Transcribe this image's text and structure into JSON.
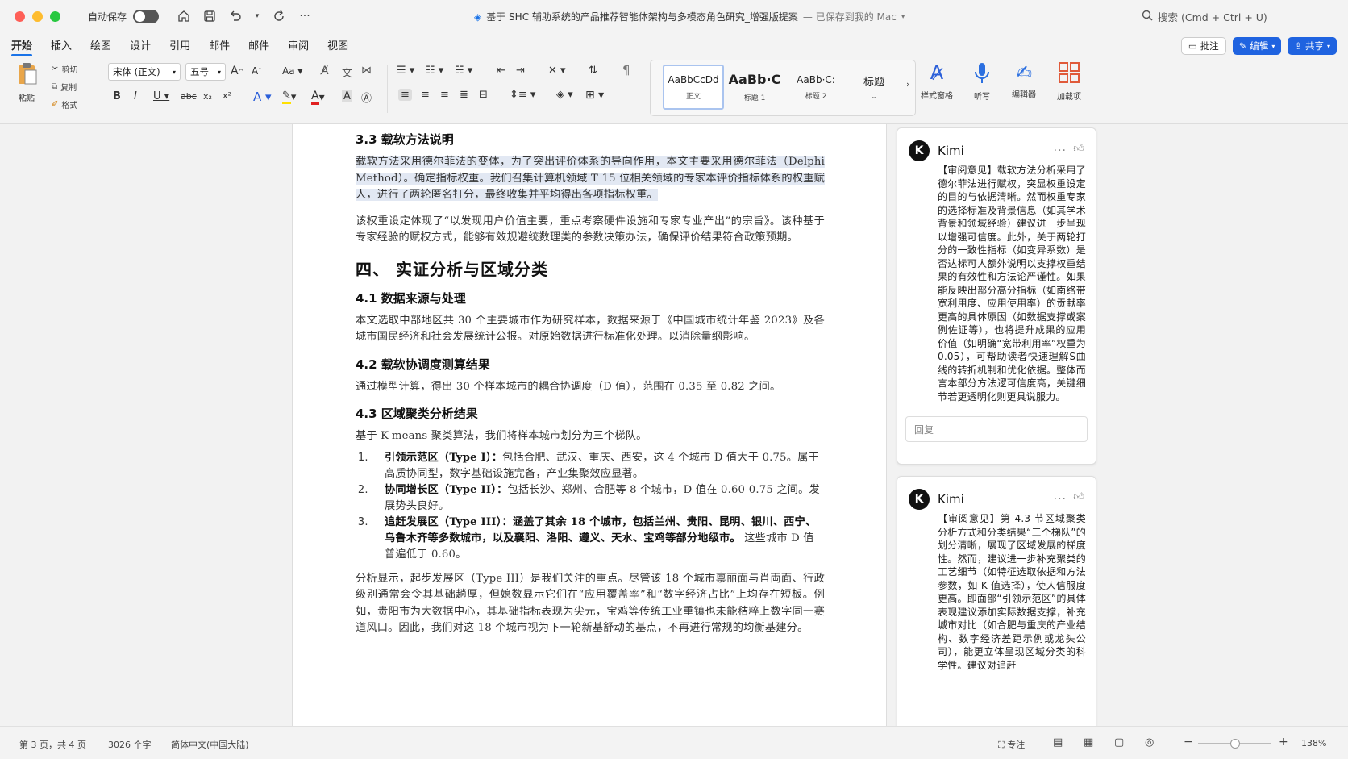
{
  "titlebar": {
    "autosave_label": "自动保存",
    "doc_title": "基于 SHC 辅助系统的产品推荐智能体架构与多模态角色研究_增强版提案",
    "saved_status": "— 已保存到我的 Mac",
    "search_placeholder": "搜索 (Cmd + Ctrl + U)"
  },
  "tabs": [
    "开始",
    "插入",
    "绘图",
    "设计",
    "引用",
    "邮件",
    "邮件",
    "审阅",
    "视图"
  ],
  "ribbon_buttons": {
    "comment": "批注",
    "edit": "编辑",
    "share": "共享"
  },
  "toolbar": {
    "paste": "粘贴",
    "cut": "剪切",
    "copy": "复制",
    "format_painter": "格式",
    "font_name": "宋体 (正文)",
    "font_size": "五号",
    "styles": [
      {
        "preview": "AaBbCcDd",
        "caption": "正文"
      },
      {
        "preview": "AaBb·C",
        "caption": "标题 1"
      },
      {
        "preview": "AaBb·C:",
        "caption": "标题 2"
      },
      {
        "preview": "标题",
        "caption": "--"
      }
    ],
    "style_pane": "样式窗格",
    "dictate": "听写",
    "editor": "编辑器",
    "addins": "加载项"
  },
  "document": {
    "sec33_title": "3.3 载软方法说明",
    "sec33_p1": "载软方法采用德尔菲法的变体，为了突出评价体系的导向作用，本文主要采用德尔菲法（Delphi Method）。确定指标权重。我们召集计算机领域 T 15 位相关领域的专家本评价指标体系的权重赋人，进行了两轮匿名打分，最终收集并平均得出各项指标权重。",
    "sec33_p2": "该权重设定体现了“以发现用户价值主要，重点考察硬件设施和专家专业产出”的宗旨》。该种基于专家经验的赋权方式，能够有效规避统数理类的参数决策办法，确保评价结果符合政策预期。",
    "ch4_title": "四、 实证分析与区域分类",
    "sec41_title": "4.1 数据来源与处理",
    "sec41_p": "本文选取中部地区共  30  个主要城市作为研究样本，数据来源于《中国城市统计年鉴 2023》及各城市国民经济和社会发展统计公报。对原始数据进行标准化处理。以消除量纲影响。",
    "sec42_title": "4.2 载软协调度测算结果",
    "sec42_p": "通过模型计算，得出 30 个样本城市的耦合协调度（D 值），范围在 0.35 至 0.82  之间。",
    "sec43_title": "4.3 区域聚类分析结果",
    "sec43_intro": "基于 K-means 聚类算法，我们将样本城市划分为三个梯队。",
    "list": [
      {
        "head": "引领示范区（Type I）：",
        "body": "包括合肥、武汉、重庆、西安，这 4 个城市 D 值大于 0.75。属于高质协同型，数字基础设施完备，产业集聚效应显著。"
      },
      {
        "head": "协同增长区（Type II）：",
        "body": "包括长沙、郑州、合肥等 8 个城市，D 值在 0.60-0.75 之间。发展势头良好。"
      },
      {
        "head": "追赶发展区（Type III）：",
        "body": "涵盖了其余 18 个城市，包括兰州、贵阳、昆明、银川、西宁、乌鲁木齐等多数城市，以及襄阳、洛阳、遵义、天水、宝鸡等部分地级市。",
        "tail": "这些城市 D 值普遍低于 0.60。"
      }
    ],
    "analysis_p": "分析显示，起步发展区（Type III）是我们关注的重点。尽管该 18 个城市禀丽面与肖両面、行政级别通常会令其基础趟厚，但媳数显示它们在“应用覆盖率”和“数字经济占比”上均存在短板。例如，贵阳市为大数据中心，其基础指标表现为尖元，宝鸡等传统工业重镇也未能秸粹上数字同一赛道风口。因此，我们对这 18 个城市视为下一轮新基舒动的基点，不再进行常规的均衡基建分。"
  },
  "comments": [
    {
      "author": "Kimi",
      "avatar": "K",
      "text": "【审阅意见】载软方法分析采用了德尔菲法进行赋权，突显权重设定的目的与依据清晰。然而权重专家的选择标准及背景信息（如其学术背景和领域经验）建议进一步呈现以增强可信度。此外，关于两轮打分的一致性指标（如变异系数）是否达标可人额外说明以支撑权重结果的有效性和方法论严谨性。如果能反映出部分高分指标（如南络带宽利用度、应用使用率）的贡献率更高的具体原因（如数据支撑或案例佐证等），也将提升成果的应用价值（如明确“宽带利用率”权重为 0.05），可帮助读者快速理解S曲线的转折机制和优化依据。整体而言本部分方法逻可信度高，关键细节若更透明化则更具说服力。",
      "reply_placeholder": "回复"
    },
    {
      "author": "Kimi",
      "avatar": "K",
      "text": "【审阅意见】第 4.3 节区域聚类分析方式和分类结果“三个梯队”的划分清晰，展现了区域发展的梯度性。然而，建议进一步补充聚类的工艺细节（如特征选取依据和方法参数，如 K 值选择），使人信服度更高。即面部“引领示范区”的具体表现建议添加实际数据支撑，补充城市对比（如合肥与重庆的产业结构、数字经济差距示例或龙头公司），能更立体呈现区域分类的科学性。建议对追赶"
    }
  ],
  "status": {
    "page": "第 3 页，共 4 页",
    "words": "3026 个字",
    "language": "简体中文(中国大陆)",
    "focus": "专注",
    "zoom": "138%"
  },
  "colors": {
    "accent": "#1a73e8",
    "share_blue": "#1f63e0",
    "selection": "#e2e8f3"
  }
}
